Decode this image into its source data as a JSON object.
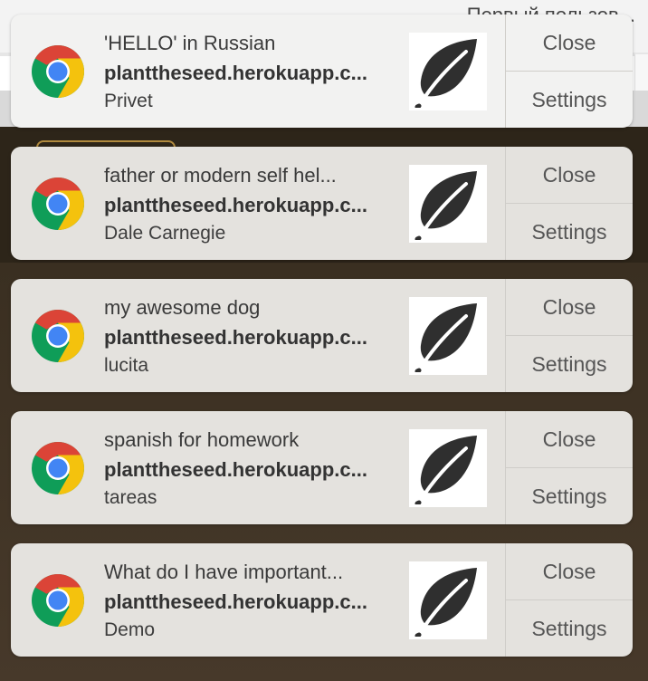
{
  "background": {
    "partial_text": "Первый пользов..."
  },
  "notifications": [
    {
      "title": "'HELLO' in Russian",
      "origin": "planttheseed.herokuapp.c...",
      "body": "Privet",
      "close_label": "Close",
      "settings_label": "Settings"
    },
    {
      "title": "father or modern self hel...",
      "origin": "planttheseed.herokuapp.c...",
      "body": "Dale Carnegie",
      "close_label": "Close",
      "settings_label": "Settings"
    },
    {
      "title": "my awesome dog",
      "origin": "planttheseed.herokuapp.c...",
      "body": "lucita",
      "close_label": "Close",
      "settings_label": "Settings"
    },
    {
      "title": "spanish for homework",
      "origin": "planttheseed.herokuapp.c...",
      "body": "tareas",
      "close_label": "Close",
      "settings_label": "Settings"
    },
    {
      "title": "What do I have important...",
      "origin": "planttheseed.herokuapp.c...",
      "body": "Demo",
      "close_label": "Close",
      "settings_label": "Settings"
    }
  ],
  "icons": {
    "app_icon": "chrome-icon",
    "thumbnail": "leaf-icon"
  },
  "colors": {
    "leaf": "#2f2f2f",
    "chrome_red": "#db4437",
    "chrome_yellow": "#f4c20d",
    "chrome_green": "#0f9d58",
    "chrome_blue": "#4285f4"
  }
}
